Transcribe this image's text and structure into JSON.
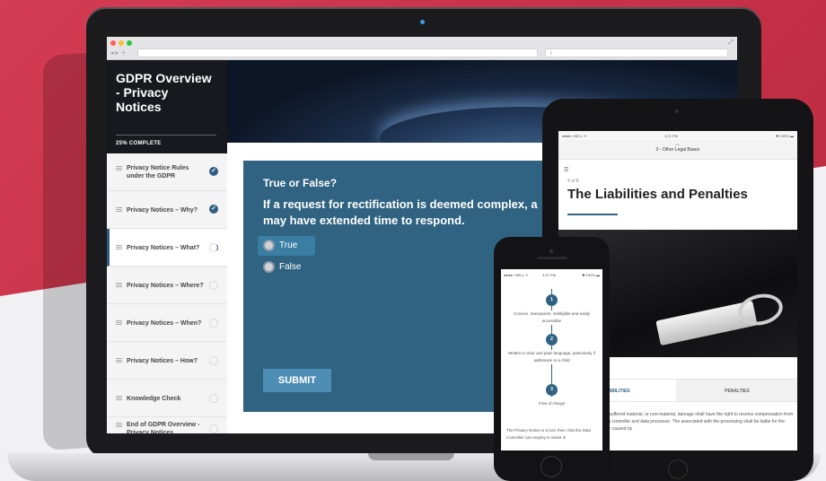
{
  "course": {
    "title": "GDPR Overview - Privacy Notices",
    "progress_label": "25% COMPLETE"
  },
  "lessons": [
    {
      "label": "Privacy Notice Rules under the GDPR",
      "status": "complete"
    },
    {
      "label": "Privacy Notices – Why?",
      "status": "complete"
    },
    {
      "label": "Privacy Notices – What?",
      "status": "in-progress"
    },
    {
      "label": "Privacy Notices – Where?",
      "status": "incomplete"
    },
    {
      "label": "Privacy Notices – When?",
      "status": "incomplete"
    },
    {
      "label": "Privacy Notices – How?",
      "status": "incomplete"
    },
    {
      "label": "Knowledge Check",
      "status": "incomplete"
    },
    {
      "label": "End of GDPR Overview - Privacy Notices",
      "status": "incomplete"
    }
  ],
  "quiz": {
    "heading": "True or False?",
    "question": "If a request for rectification is deemed complex, a",
    "question_line2": "may have extended time to respond.",
    "options": [
      "True",
      "False"
    ],
    "selected": "True",
    "submit_label": "SUBMIT"
  },
  "tablet": {
    "status_left": "●●●●○ BELL ᯤ",
    "status_time": "4:21 PM",
    "status_right": "✱ 100% ▬",
    "nav_label": "3 - Other Legal Bases",
    "small_label": "4 of 8",
    "title": "The Liabilities and Penalties",
    "tabs": [
      "LIABILITIES",
      "PENALTIES"
    ],
    "body": "no has suffered material, or non-material, damage shall have the right to receive compensation from the data controller and data processor. The associated with the processing shall be liable for the damage caused by"
  },
  "phone": {
    "status_left": "●●●●○ BELL ᯤ",
    "status_time": "4:21 PM",
    "status_right": "✱ 100% ▬",
    "steps": [
      {
        "num": "1",
        "text": "Concise, transparent, intelligible and easily accessible"
      },
      {
        "num": "2",
        "text": "Written in clear and plain language, particularly if addresses to a child"
      },
      {
        "num": "3",
        "text": "Free of charge"
      }
    ],
    "footer_text": "The Privacy Notice is a tool, then, that the Data Controller can employ to assist in"
  },
  "colors": {
    "brand_red": "#c8334a",
    "primary_blue": "#2f6381",
    "accent_blue": "#4e8db4",
    "sidebar_dark": "#17191f"
  }
}
